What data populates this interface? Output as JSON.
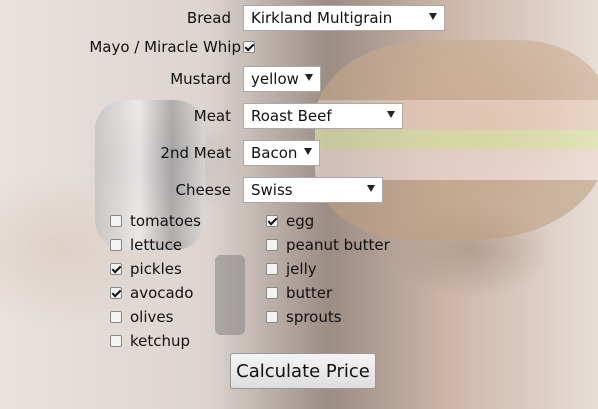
{
  "form": {
    "bread": {
      "label": "Bread",
      "value": "Kirkland Multigrain"
    },
    "mayo": {
      "label": "Mayo / Miracle Whip",
      "checked": true
    },
    "mustard": {
      "label": "Mustard",
      "value": "yellow"
    },
    "meat": {
      "label": "Meat",
      "value": "Roast Beef"
    },
    "second_meat": {
      "label": "2nd Meat",
      "value": "Bacon"
    },
    "cheese": {
      "label": "Cheese",
      "value": "Swiss"
    }
  },
  "toppings": [
    {
      "label": "tomatoes",
      "checked": false
    },
    {
      "label": "lettuce",
      "checked": false
    },
    {
      "label": "pickles",
      "checked": true
    },
    {
      "label": "avocado",
      "checked": true
    },
    {
      "label": "olives",
      "checked": false
    },
    {
      "label": "ketchup",
      "checked": false
    },
    {
      "label": "egg",
      "checked": true
    },
    {
      "label": "peanut butter",
      "checked": false
    },
    {
      "label": "jelly",
      "checked": false
    },
    {
      "label": "butter",
      "checked": false
    },
    {
      "label": "sprouts",
      "checked": false
    }
  ],
  "button": {
    "label": "Calculate Price"
  },
  "icons": {
    "dropdown": "chevron-down-icon",
    "checkbox": "checkmark-icon"
  }
}
